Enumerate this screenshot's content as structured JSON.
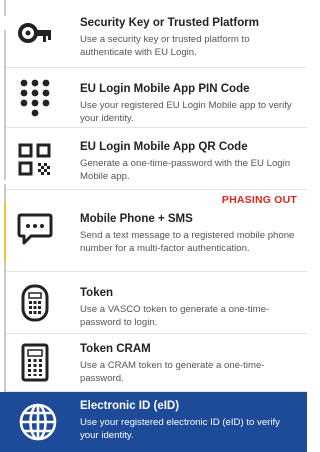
{
  "options": [
    {
      "id": "security-key",
      "title": "Security Key or Trusted Platform",
      "description": "Use a security key or trusted platform to authenticate with EU Login.",
      "icon": "key-icon",
      "selected": false
    },
    {
      "id": "mobile-pin",
      "title": "EU Login Mobile App PIN Code",
      "description": "Use your registered EU Login Mobile app to verify your identity.",
      "icon": "keypad-icon",
      "selected": false
    },
    {
      "id": "mobile-qr",
      "title": "EU Login Mobile App QR Code",
      "description": "Generate a one-time-password with the EU Login Mobile app.",
      "icon": "qr-code-icon",
      "selected": false
    },
    {
      "id": "sms",
      "title": "Mobile Phone + SMS",
      "description": "Send a text message to a registered mobile phone number for a multi-factor authentication.",
      "badge": "PHASING OUT",
      "icon": "sms-message-icon",
      "selected": false
    },
    {
      "id": "token",
      "title": "Token",
      "description": "Use a VASCO token to generate a one-time-password to login.",
      "icon": "token-device-icon",
      "selected": false
    },
    {
      "id": "token-cram",
      "title": "Token CRAM",
      "description": "Use a CRAM token to generate a one-time-password.",
      "icon": "calculator-token-icon",
      "selected": false
    },
    {
      "id": "eid",
      "title": "Electronic ID (eID)",
      "description": "Use your registered electronic ID (eID) to verify your identity.",
      "icon": "globe-icon",
      "selected": true
    }
  ],
  "colors": {
    "selected_background": "#1d4a99",
    "phasing_out": "#e2231a",
    "icon": "#222222"
  }
}
